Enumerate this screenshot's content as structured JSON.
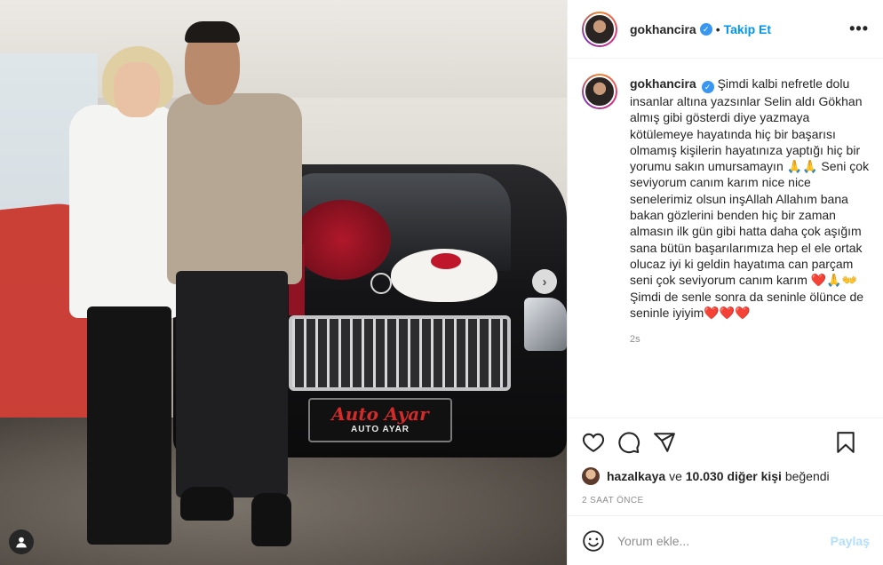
{
  "post": {
    "username": "gokhancira",
    "follow_label": "Takip Et",
    "separator": "•",
    "more_label": "•••",
    "caption": "Şimdi kalbi nefretle dolu insanlar altına yazsınlar Selin aldı Gökhan almış gibi gösterdi diye yazmaya kötülemeye hayatında hiç bir başarısı olmamış kişilerin hayatınıza yaptığı hiç bir yorumu sakın umursamayın 🙏🙏 Seni çok seviyorum canım karım nice nice senelerimiz olsun inşAllah Allahım bana bakan gözlerini benden hiç bir zaman almasın ilk gün gibi hatta daha çok aşığım sana bütün başarılarımıza hep el ele ortak olucaz iyi ki geldin hayatıma can parçam seni çok seviyorum canım karım ❤️🙏👐 Şimdi de senle sonra da seninle ölünce de seninle iyiyim❤️❤️❤️",
    "time_ago": "2s"
  },
  "image": {
    "plate_brand": "Auto Ayar",
    "plate_sub": "AUTO AYAR"
  },
  "likes": {
    "liker": "hazalkaya",
    "connector": "ve",
    "count_text": "10.030 diğer kişi",
    "suffix": "beğendi"
  },
  "posted_time": "2 SAAT ÖNCE",
  "comment": {
    "placeholder": "Yorum ekle...",
    "submit_label": "Paylaş"
  },
  "icons": [
    "heart-icon",
    "comment-icon",
    "share-icon",
    "bookmark-icon",
    "emoji-icon",
    "next-arrow-icon",
    "user-tag-icon",
    "verified-icon"
  ],
  "colors": {
    "link_blue": "#0095f6",
    "verified_blue": "#3897f0",
    "muted": "#8e8e8e",
    "share_disabled": "#b2dffc"
  }
}
